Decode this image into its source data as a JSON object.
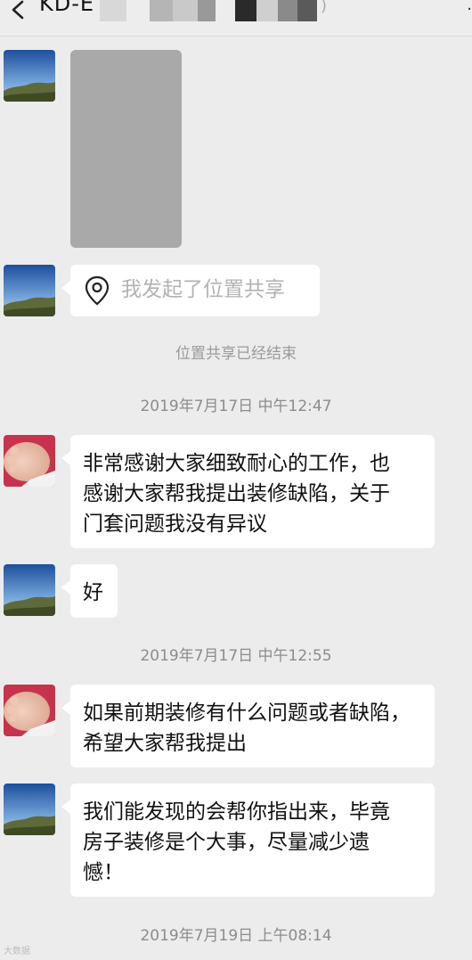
{
  "header": {
    "title": "KD-E",
    "title_suffix": ")",
    "right_mark": "·"
  },
  "messages": [
    {
      "type": "image",
      "sender": "landscape-avatar"
    },
    {
      "type": "location-share",
      "sender": "landscape-avatar",
      "text": "我发起了位置共享"
    },
    {
      "type": "system",
      "text": "位置共享已经结束"
    },
    {
      "type": "timestamp",
      "text": "2019年7月17日 中午12:47"
    },
    {
      "type": "text",
      "sender": "baby-avatar",
      "lines": [
        "非常感谢大家细致耐心的工作，也",
        "感谢大家帮我提出装修缺陷，关于",
        "门套问题我没有异议"
      ]
    },
    {
      "type": "text",
      "sender": "landscape-avatar",
      "lines": [
        "好"
      ]
    },
    {
      "type": "timestamp",
      "text": "2019年7月17日 中午12:55"
    },
    {
      "type": "text",
      "sender": "baby-avatar",
      "lines": [
        "如果前期装修有什么问题或者缺陷，",
        "希望大家帮我提出"
      ]
    },
    {
      "type": "text",
      "sender": "landscape-avatar",
      "lines": [
        "我们能发现的会帮你指出来，毕竟",
        "房子装修是个大事，尽量减少遗",
        "憾！"
      ]
    },
    {
      "type": "timestamp",
      "text": "2019年7月19日 上午08:14"
    }
  ],
  "watermark": "大数据"
}
